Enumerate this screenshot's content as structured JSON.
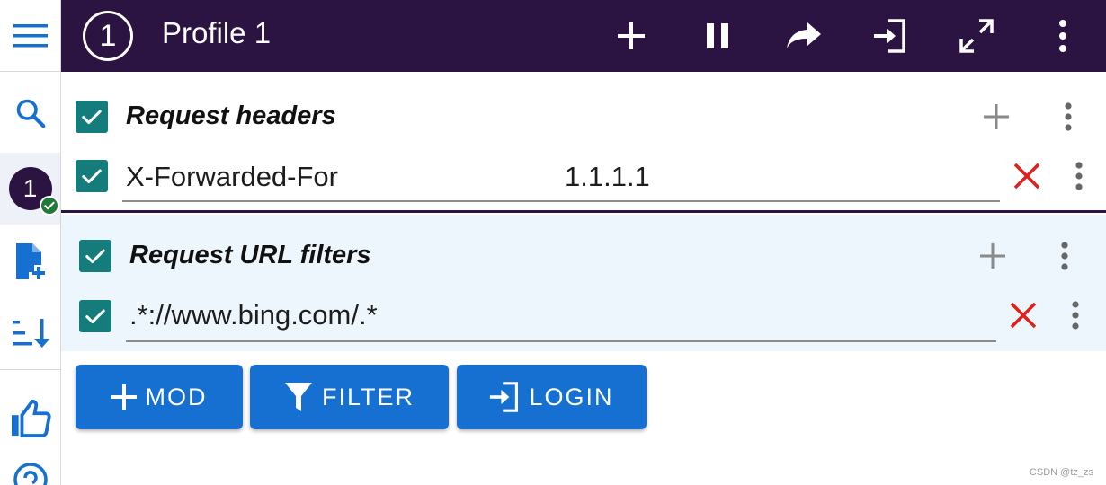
{
  "header": {
    "profile_number": "1",
    "profile_title": "Profile 1"
  },
  "sidebar": {
    "active_profile_number": "1"
  },
  "request_headers": {
    "title": "Request headers",
    "rows": [
      {
        "name": "X-Forwarded-For",
        "value": "1.1.1.1"
      }
    ]
  },
  "url_filters": {
    "title": "Request URL filters",
    "rows": [
      {
        "pattern": ".*://www.bing.com/.*"
      }
    ]
  },
  "actions": {
    "mod_label": "MOD",
    "filter_label": "FILTER",
    "login_label": "LOGIN"
  },
  "watermark": "CSDN @tz_zs",
  "colors": {
    "topbar": "#2b1441",
    "checkbox": "#147d7c",
    "accent_blue": "#1670d1",
    "delete_red": "#e0201c",
    "filters_bg": "#eef6fd"
  }
}
